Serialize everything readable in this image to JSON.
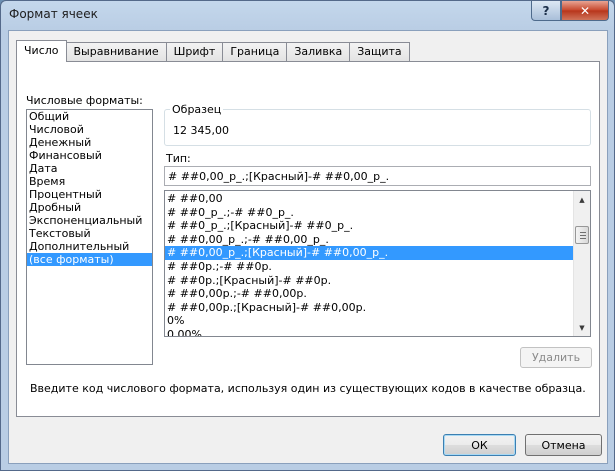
{
  "window": {
    "title": "Формат ячеек",
    "help_label": "?",
    "close_label": "✕"
  },
  "tabs": [
    {
      "label": "Число",
      "active": true
    },
    {
      "label": "Выравнивание",
      "active": false
    },
    {
      "label": "Шрифт",
      "active": false
    },
    {
      "label": "Граница",
      "active": false
    },
    {
      "label": "Заливка",
      "active": false
    },
    {
      "label": "Защита",
      "active": false
    }
  ],
  "categories": {
    "label": "Числовые форматы:",
    "items": [
      {
        "label": "Общий",
        "selected": false
      },
      {
        "label": "Числовой",
        "selected": false
      },
      {
        "label": "Денежный",
        "selected": false
      },
      {
        "label": "Финансовый",
        "selected": false
      },
      {
        "label": "Дата",
        "selected": false
      },
      {
        "label": "Время",
        "selected": false
      },
      {
        "label": "Процентный",
        "selected": false
      },
      {
        "label": "Дробный",
        "selected": false
      },
      {
        "label": "Экспоненциальный",
        "selected": false
      },
      {
        "label": "Текстовый",
        "selected": false
      },
      {
        "label": "Дополнительный",
        "selected": false
      },
      {
        "label": "(все форматы)",
        "selected": true
      }
    ]
  },
  "sample": {
    "caption": "Образец",
    "value": "12 345,00"
  },
  "type": {
    "label": "Тип:",
    "value": "# ##0,00_р_.;[Красный]-# ##0,00_р_."
  },
  "formats": {
    "items": [
      {
        "label": "# ##0,00",
        "selected": false
      },
      {
        "label": "# ##0_р_.;-# ##0_р_.",
        "selected": false
      },
      {
        "label": "# ##0_р_.;[Красный]-# ##0_р_.",
        "selected": false
      },
      {
        "label": "# ##0,00_р_.;-# ##0,00_р_.",
        "selected": false
      },
      {
        "label": "# ##0,00_р_.;[Красный]-# ##0,00_р_.",
        "selected": true
      },
      {
        "label": "# ##0р.;-# ##0р.",
        "selected": false
      },
      {
        "label": "# ##0р.;[Красный]-# ##0р.",
        "selected": false
      },
      {
        "label": "# ##0,00р.;-# ##0,00р.",
        "selected": false
      },
      {
        "label": "# ##0,00р.;[Красный]-# ##0,00р.",
        "selected": false
      },
      {
        "label": "0%",
        "selected": false
      },
      {
        "label": "0,00%",
        "selected": false
      }
    ]
  },
  "delete_label": "Удалить",
  "hint": "Введите код числового формата, используя один из существующих кодов в качестве образца.",
  "buttons": {
    "ok": "ОК",
    "cancel": "Отмена"
  },
  "colors": {
    "selection": "#3399ff",
    "close_button": "#c6452a",
    "title_bar": "#c4d7ec"
  }
}
